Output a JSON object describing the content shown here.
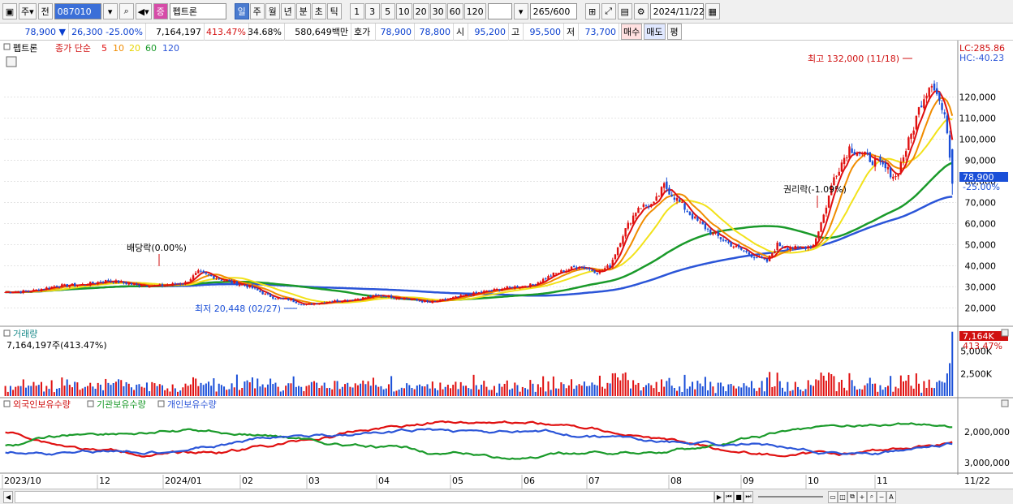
{
  "toolbar": {
    "mode1": "주",
    "mode2": "전",
    "code": "087010",
    "stock_badge": "증",
    "stock_name": "펩트론",
    "period_tabs": [
      "일",
      "주",
      "월",
      "년",
      "분",
      "초",
      "틱"
    ],
    "active_period": "일",
    "intervals": [
      "1",
      "3",
      "5",
      "10",
      "20",
      "30",
      "60",
      "120"
    ],
    "count": "265",
    "count_total": "/600",
    "date": "2024/11/22"
  },
  "quote": {
    "price": "78,900",
    "arrow": "▼",
    "change": "26,300",
    "change_pct": "-25.00%",
    "volume": "7,164,197",
    "volume_pct": "413.47%",
    "turnover": "34.68%",
    "amount": "580,649백만",
    "bid_label": "호가",
    "bid": "78,900",
    "ask": "78,800",
    "open_label": "시",
    "open": "95,200",
    "high_label": "고",
    "high": "95,500",
    "low_label": "저",
    "low": "73,700",
    "buy_label": "매수",
    "sell_label": "매도",
    "avg_label": "평"
  },
  "colors": {
    "up": "#e01010",
    "down": "#1a4fd8",
    "ma5": "#e01010",
    "ma10": "#f08c00",
    "ma20": "#f2e21a",
    "ma60": "#1a9a2a",
    "ma120": "#2b55d8",
    "foreign": "#e01010",
    "inst": "#1a9a2a",
    "indiv": "#2b55d8"
  },
  "chart_data": [
    {
      "type": "candlestick",
      "name": "펩트론",
      "legend": {
        "title": "펩트론",
        "label": "종가 단순",
        "periods": [
          "5",
          "10",
          "20",
          "60",
          "120"
        ]
      },
      "right_top": [
        "LC:285.86",
        "HC:-40.23"
      ],
      "ylim": [
        14000,
        141000
      ],
      "y_ticks": [
        20000,
        30000,
        40000,
        50000,
        60000,
        70000,
        80000,
        90000,
        100000,
        110000,
        120000
      ],
      "y_tick_labels": [
        "20,000",
        "30,000",
        "40,000",
        "50,000",
        "60,000",
        "70,000",
        "80,000",
        "90,000",
        "100,000",
        "110,000",
        "120,000"
      ],
      "current_price_label": "78,900",
      "current_pct_label": "-25.00%",
      "annotations": {
        "high": "최고 132,000 (11/18)",
        "low": "최저 20,448 (02/27)",
        "dividend": "배당락(0.00%)",
        "rights": "권리락(-1.09%)"
      },
      "x_labels": [
        "2023/10",
        "12",
        "2024/01",
        "02",
        "03",
        "04",
        "05",
        "06",
        "07",
        "08",
        "09",
        "10",
        "11",
        "11/22"
      ],
      "closes_approx": [
        [
          0,
          27500
        ],
        [
          10,
          28000
        ],
        [
          20,
          30500
        ],
        [
          30,
          31000
        ],
        [
          40,
          33000
        ],
        [
          50,
          31000
        ],
        [
          60,
          30500
        ],
        [
          70,
          32000
        ],
        [
          75,
          37000
        ],
        [
          85,
          33000
        ],
        [
          95,
          30000
        ],
        [
          100,
          27000
        ],
        [
          105,
          24500
        ],
        [
          110,
          24000
        ],
        [
          116,
          21500
        ],
        [
          125,
          23000
        ],
        [
          135,
          24000
        ],
        [
          145,
          26000
        ],
        [
          155,
          24500
        ],
        [
          165,
          22500
        ],
        [
          175,
          25000
        ],
        [
          185,
          27500
        ],
        [
          195,
          29500
        ],
        [
          205,
          31000
        ],
        [
          213,
          36000
        ],
        [
          223,
          40000
        ],
        [
          230,
          37000
        ],
        [
          235,
          40000
        ],
        [
          240,
          55000
        ],
        [
          246,
          68000
        ],
        [
          252,
          69000
        ],
        [
          256,
          78000
        ],
        [
          262,
          70000
        ],
        [
          268,
          62000
        ],
        [
          274,
          56000
        ],
        [
          282,
          50000
        ],
        [
          290,
          45000
        ],
        [
          296,
          42000
        ],
        [
          300,
          50000
        ],
        [
          308,
          48000
        ],
        [
          314,
          50000
        ],
        [
          318,
          64000
        ],
        [
          322,
          82000
        ],
        [
          328,
          96000
        ],
        [
          334,
          92000
        ],
        [
          340,
          88000
        ],
        [
          346,
          82000
        ],
        [
          352,
          102000
        ],
        [
          356,
          118000
        ],
        [
          360,
          128000
        ],
        [
          363,
          118000
        ],
        [
          366,
          105000
        ],
        [
          368,
          78900
        ]
      ]
    },
    {
      "type": "bar",
      "name": "거래량",
      "value_label": "7,164,197주(413.47%)",
      "right_label": "7,164K",
      "right_pct": "413.47%",
      "y_ticks": [
        2500000,
        5000000
      ],
      "y_tick_labels": [
        "2,500K",
        "5,000K"
      ],
      "ylim": [
        0,
        7500000
      ],
      "last_volume": 7164197
    },
    {
      "type": "line",
      "series": [
        {
          "name": "외국인보유수량"
        },
        {
          "name": "기관보유수량"
        },
        {
          "name": "개인보유수량"
        }
      ],
      "y_ticks": [
        2000000,
        3000000
      ],
      "y_tick_labels": [
        "2,000,000",
        "3,000,000"
      ]
    }
  ]
}
